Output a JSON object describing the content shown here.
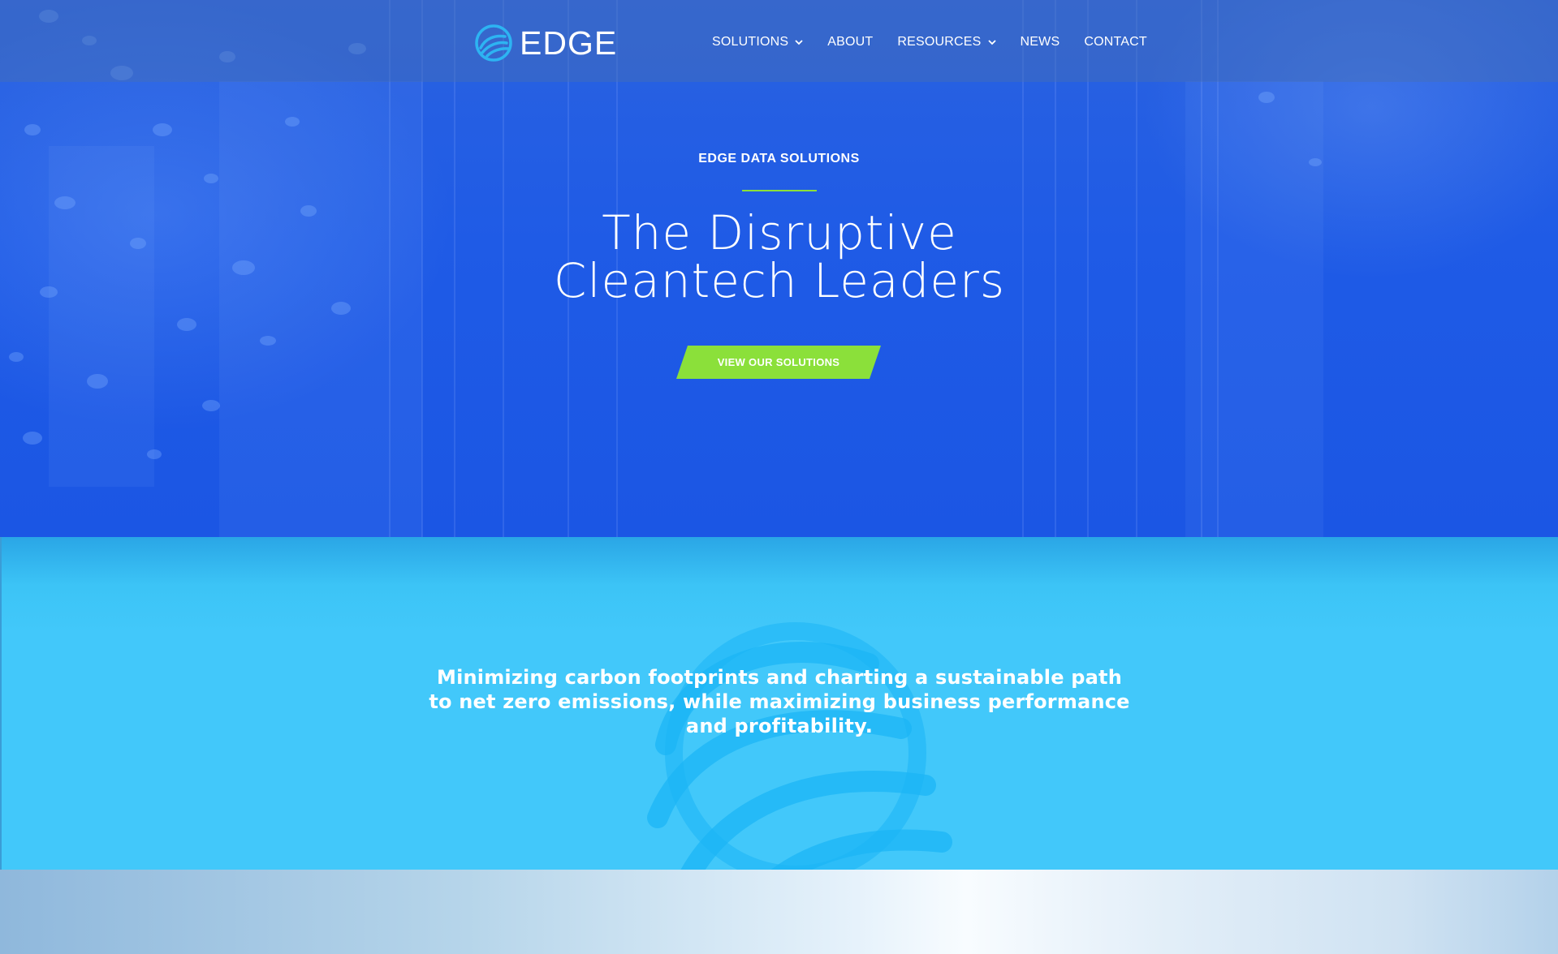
{
  "header": {
    "logo_text": "EDGE",
    "nav": [
      {
        "label": "SOLUTIONS",
        "has_dropdown": true
      },
      {
        "label": "ABOUT",
        "has_dropdown": false
      },
      {
        "label": "RESOURCES",
        "has_dropdown": true
      },
      {
        "label": "NEWS",
        "has_dropdown": false
      },
      {
        "label": "CONTACT",
        "has_dropdown": false
      }
    ]
  },
  "hero": {
    "eyebrow": "EDGE DATA SOLUTIONS",
    "title_line1": "The Disruptive",
    "title_line2": "Cleantech Leaders",
    "cta_label": "VIEW OUR SOLUTIONS"
  },
  "mission": {
    "text": "Minimizing carbon footprints and charting a sustainable path to net zero emissions, while maximizing business performance and profitability."
  },
  "colors": {
    "hero_blue": "#1f5be6",
    "accent_green": "#8be03a",
    "mission_cyan": "#42c8fa",
    "logo_cyan": "#2db4f2"
  },
  "icons": {
    "logo": "edge-logo-mark",
    "dropdown": "chevron-down-icon"
  }
}
